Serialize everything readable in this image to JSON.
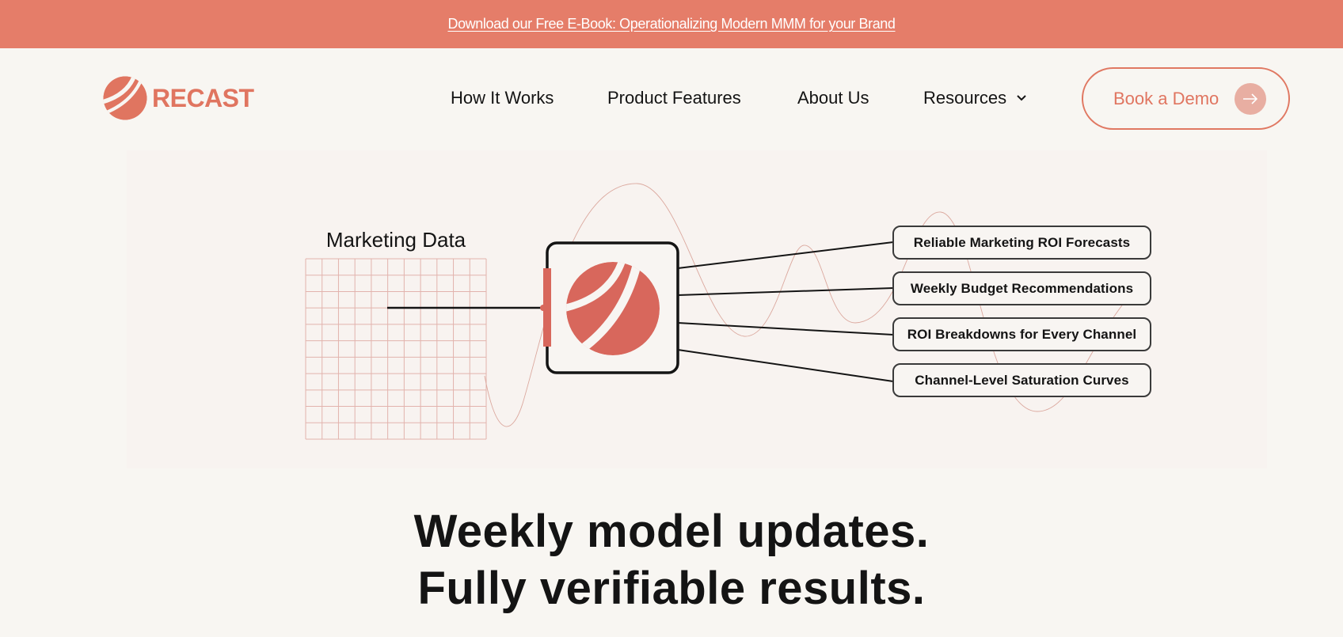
{
  "announcement": {
    "text": "Download our Free E-Book: Operationalizing Modern MMM for your Brand"
  },
  "brand": {
    "name": "RECAST",
    "accent_color": "#e07560",
    "banner_color": "#e57d69"
  },
  "nav": {
    "items": [
      {
        "label": "How It Works"
      },
      {
        "label": "Product Features"
      },
      {
        "label": "About Us"
      },
      {
        "label": "Resources",
        "icon": "chevron-down-icon"
      }
    ],
    "cta": {
      "label": "Book a Demo",
      "icon": "arrow-right-icon"
    }
  },
  "diagram": {
    "input_label": "Marketing Data",
    "center_icon": "recast-logo-icon",
    "outputs": [
      "Reliable Marketing ROI Forecasts",
      "Weekly Budget Recommendations",
      "ROI Breakdowns for Every Channel",
      "Channel-Level Saturation Curves"
    ]
  },
  "hero": {
    "headline_line1": "Weekly model updates.",
    "headline_line2": "Fully verifiable results."
  }
}
